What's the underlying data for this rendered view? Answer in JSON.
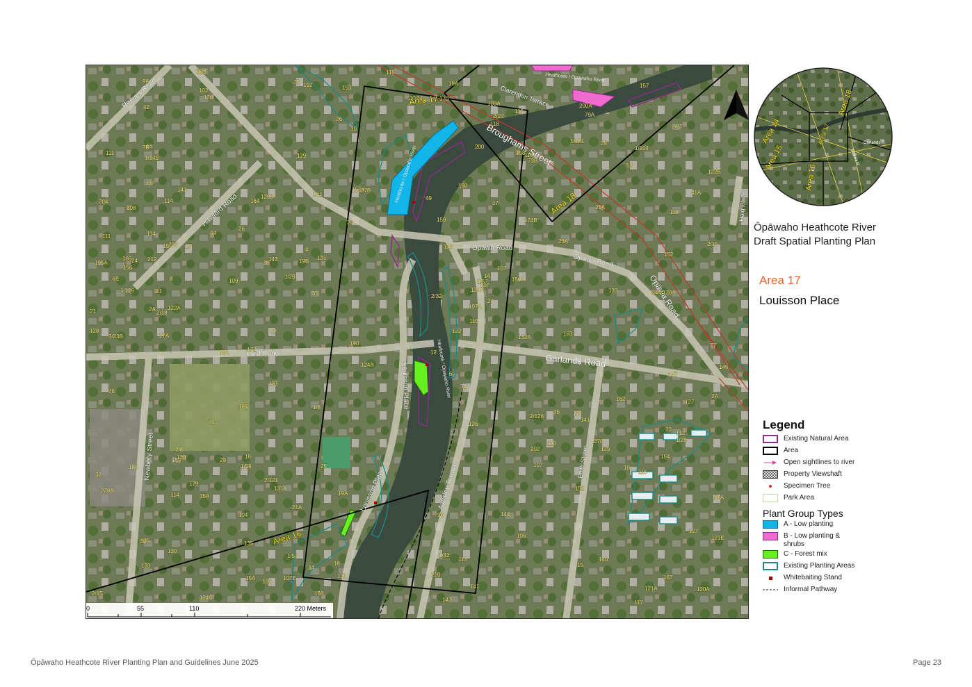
{
  "map": {
    "streets": [
      {
        "name": "Reeves Road"
      },
      {
        "name": "Hawford Road"
      },
      {
        "name": "Ford Road"
      },
      {
        "name": "Broughams Street"
      },
      {
        "name": "Opawa Road"
      },
      {
        "name": "Garlands Road"
      },
      {
        "name": "Clarendon Terrace"
      },
      {
        "name": "Louisson Place"
      },
      {
        "name": "Aynsley Terrace"
      },
      {
        "name": "Newbery Street"
      },
      {
        "name": "Edith Street"
      },
      {
        "name": "Haig Place"
      },
      {
        "name": "Heathcote / Opawaho River"
      }
    ],
    "plot_numbers": [
      "114",
      "125",
      "129A",
      "131A",
      "116",
      "118",
      "122",
      "120",
      "120A",
      "122A",
      "122B",
      "124A",
      "124B",
      "124C",
      "126",
      "129",
      "131",
      "133",
      "135",
      "137",
      "141",
      "143",
      "1/126",
      "2/126",
      "2/15",
      "120B",
      "1/121",
      "2/121",
      "121A",
      "127",
      "115",
      "19A",
      "19B",
      "109",
      "107",
      "105",
      "105A",
      "107A",
      "110",
      "114",
      "118",
      "111",
      "110",
      "106",
      "104",
      "102",
      "98",
      "96",
      "1/104",
      "2/104",
      "22",
      "24",
      "26",
      "28",
      "1/24",
      "2/24",
      "30",
      "32",
      "34",
      "36",
      "38",
      "40",
      "42",
      "44",
      "46",
      "1/42",
      "2/32",
      "130",
      "132A",
      "132",
      "130A",
      "140",
      "142",
      "144",
      "146",
      "150A",
      "152",
      "154",
      "156",
      "158",
      "73B",
      "75A",
      "75",
      "77",
      "69",
      "71",
      "1/59",
      "1/57",
      "2/57",
      "53",
      "55",
      "147",
      "1/149",
      "190",
      "192",
      "188",
      "2/67",
      "153A",
      "153",
      "155",
      "157",
      "159",
      "161",
      "163",
      "165",
      "167",
      "131",
      "133",
      "137",
      "139",
      "141",
      "143",
      "129",
      "127",
      "125",
      "123",
      "2/8",
      "2A",
      "4",
      "6",
      "8",
      "10",
      "12",
      "14",
      "16",
      "18",
      "15",
      "152",
      "164",
      "166",
      "168",
      "162",
      "170",
      "172",
      "150",
      "126",
      "128",
      "116",
      "118",
      "114",
      "121E",
      "119",
      "117",
      "115",
      "113",
      "111",
      "109A",
      "107",
      "107E",
      "200",
      "202",
      "204",
      "206",
      "208",
      "210",
      "212",
      "7B",
      "17",
      "19",
      "21",
      "21A",
      "23",
      "25",
      "25A",
      "27",
      "27A",
      "27B",
      "27C",
      "29",
      "2/18",
      "200A",
      "20",
      "21",
      "23A",
      "3/23B",
      "228A",
      "79A",
      "59A",
      "41A",
      "1/29",
      "1/28",
      "2/28",
      "19A",
      "35A",
      "3B",
      "1/8",
      "2A",
      "26",
      "49",
      "2/15",
      "17",
      "15A",
      "16"
    ],
    "area_labels": [
      "Area 17",
      "Area 18",
      "Area 16"
    ],
    "river_label": "Heathcote / Opawaho River",
    "scale_bar": {
      "ticks": [
        "0",
        "55",
        "110",
        "220 Meters"
      ]
    },
    "north_arrow": "north-arrow-icon"
  },
  "inset_map": {
    "labels": [
      "Area 14",
      "Area 15",
      "Area 16",
      "Area 17",
      "Area 18",
      "Garlands R",
      "Opawa R"
    ]
  },
  "title": {
    "line1": "Ōpāwaho Heathcote River",
    "line2": "Draft Spatial Planting Plan"
  },
  "area": {
    "number": "Area 17",
    "name": "Louisson Place"
  },
  "legend": {
    "title": "Legend",
    "items": [
      {
        "label": "Existing Natural Area",
        "symbol": "purple-outline",
        "color": "#8b2d8b"
      },
      {
        "label": "Area",
        "symbol": "black-outline",
        "color": "#000000"
      },
      {
        "label": "Open sightlines to river",
        "symbol": "pink-arrow",
        "color": "#e040a0"
      },
      {
        "label": "Property Viewshaft",
        "symbol": "crosshatch",
        "color": "#333333"
      },
      {
        "label": "Specimen Tree",
        "symbol": "red-dot",
        "color": "#d32f2f"
      },
      {
        "label": "Park Area",
        "symbol": "light-green-outline",
        "color": "#c8e6b0"
      }
    ],
    "plant_group_title": "Plant Group Types",
    "plant_groups": [
      {
        "label": "A - Low planting",
        "color": "#12b5e8"
      },
      {
        "label": "B - Low planting & shrubs",
        "color": "#f06ad0"
      },
      {
        "label": "C - Forest mix",
        "color": "#66f020"
      },
      {
        "label": "Existing Planting Areas",
        "color": "#1a8a8a"
      },
      {
        "label": "Whitebaiting Stand",
        "color": "#a00000"
      },
      {
        "label": "Informal Pathway",
        "color": "#222222"
      }
    ]
  },
  "footer": {
    "left": "Ōpāwaho Heathcote River Planting Plan and Guidelines June 2025",
    "right": "Page 23"
  }
}
